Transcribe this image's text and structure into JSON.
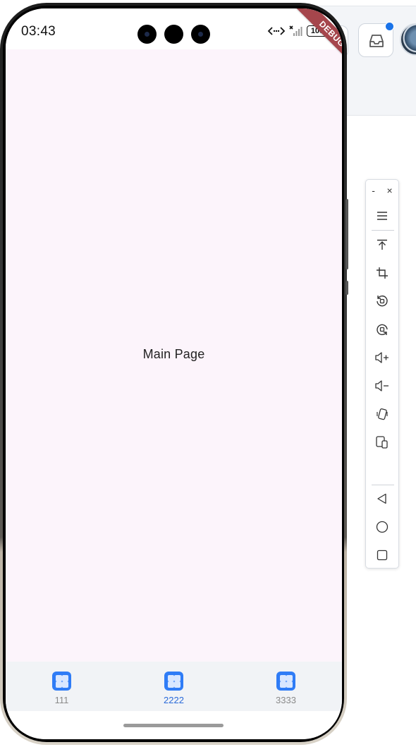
{
  "status_bar": {
    "time": "03:43",
    "battery": "100"
  },
  "debug_banner": "DEBUG",
  "main": {
    "text": "Main Page"
  },
  "bottom_nav": {
    "items": [
      {
        "label": "111",
        "active": false
      },
      {
        "label": "2222",
        "active": true
      },
      {
        "label": "3333",
        "active": false
      }
    ]
  },
  "emulator_toolbar": {
    "window_controls": {
      "minimize": "-",
      "close": "×"
    },
    "tools": [
      "menu-icon",
      "upload-top-icon",
      "crop-icon",
      "rotate-left-icon",
      "rotate-right-icon",
      "volume-up-icon",
      "volume-down-icon",
      "shake-icon",
      "multi-device-icon"
    ],
    "nav_tools": [
      "back-icon",
      "home-icon",
      "recents-icon"
    ]
  },
  "colors": {
    "accent": "#2f7cf6",
    "debug": "#a5464c",
    "screen_bg": "#fcf4fb",
    "nav_bg": "#f1f3f6"
  }
}
